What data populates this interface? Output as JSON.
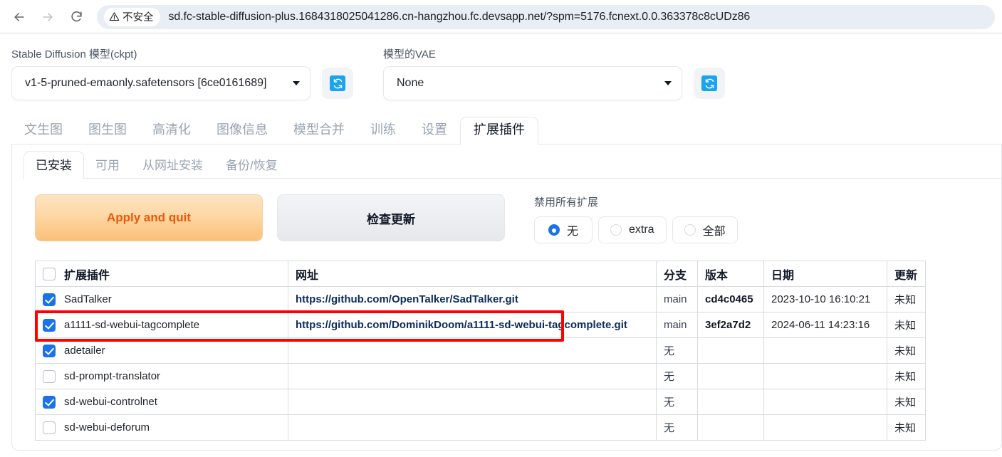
{
  "browser": {
    "back_icon": "arrow-left-icon",
    "forward_icon": "arrow-right-icon",
    "reload_icon": "reload-icon",
    "security_icon": "warning-triangle-icon",
    "security_label": "不安全",
    "url": "sd.fc-stable-diffusion-plus.1684318025041286.cn-hangzhou.fc.devsapp.net/?spm=5176.fcnext.0.0.363378c8cUDz86"
  },
  "model_bar": {
    "ckpt_label": "Stable Diffusion 模型(ckpt)",
    "ckpt_value": "v1-5-pruned-emaonly.safetensors [6ce0161689]",
    "vae_label": "模型的VAE",
    "vae_value": "None",
    "refresh_icon": "refresh-icon",
    "accent": "#1aa3ef"
  },
  "main_tabs": [
    {
      "label": "文生图",
      "active": false
    },
    {
      "label": "图生图",
      "active": false
    },
    {
      "label": "高清化",
      "active": false
    },
    {
      "label": "图像信息",
      "active": false
    },
    {
      "label": "模型合并",
      "active": false
    },
    {
      "label": "训练",
      "active": false
    },
    {
      "label": "设置",
      "active": false
    },
    {
      "label": "扩展插件",
      "active": true
    }
  ],
  "sub_tabs": [
    {
      "label": "已安装",
      "active": true
    },
    {
      "label": "可用",
      "active": false
    },
    {
      "label": "从网址安装",
      "active": false
    },
    {
      "label": "备份/恢复",
      "active": false
    }
  ],
  "actions": {
    "apply_label": "Apply and quit",
    "check_label": "检查更新",
    "apply_color": "#e8590c",
    "disable_all_label": "禁用所有扩展",
    "radios": [
      {
        "label": "无",
        "selected": true
      },
      {
        "label": "extra",
        "selected": false
      },
      {
        "label": "全部",
        "selected": false
      }
    ]
  },
  "table": {
    "header_checkbox": false,
    "columns": [
      "扩展插件",
      "网址",
      "分支",
      "版本",
      "日期",
      "更新"
    ],
    "rows": [
      {
        "checked": true,
        "name": "SadTalker",
        "url": "https://github.com/OpenTalker/SadTalker.git",
        "branch": "main",
        "version": "cd4c0465",
        "date": "2023-10-10 16:10:21",
        "update": "未知",
        "highlighted": true
      },
      {
        "checked": true,
        "name": "a1111-sd-webui-tagcomplete",
        "url": "https://github.com/DominikDoom/a1111-sd-webui-tagcomplete.git",
        "branch": "main",
        "version": "3ef2a7d2",
        "date": "2024-06-11 14:23:16",
        "update": "未知",
        "highlighted": false
      },
      {
        "checked": true,
        "name": "adetailer",
        "url": "",
        "branch": "无",
        "version": "",
        "date": "",
        "update": "未知",
        "highlighted": false
      },
      {
        "checked": false,
        "name": "sd-prompt-translator",
        "url": "",
        "branch": "无",
        "version": "",
        "date": "",
        "update": "未知",
        "highlighted": false
      },
      {
        "checked": true,
        "name": "sd-webui-controlnet",
        "url": "",
        "branch": "无",
        "version": "",
        "date": "",
        "update": "未知",
        "highlighted": false
      },
      {
        "checked": false,
        "name": "sd-webui-deforum",
        "url": "",
        "branch": "无",
        "version": "",
        "date": "",
        "update": "未知",
        "highlighted": false
      }
    ],
    "highlight_color": "#ff0000"
  }
}
